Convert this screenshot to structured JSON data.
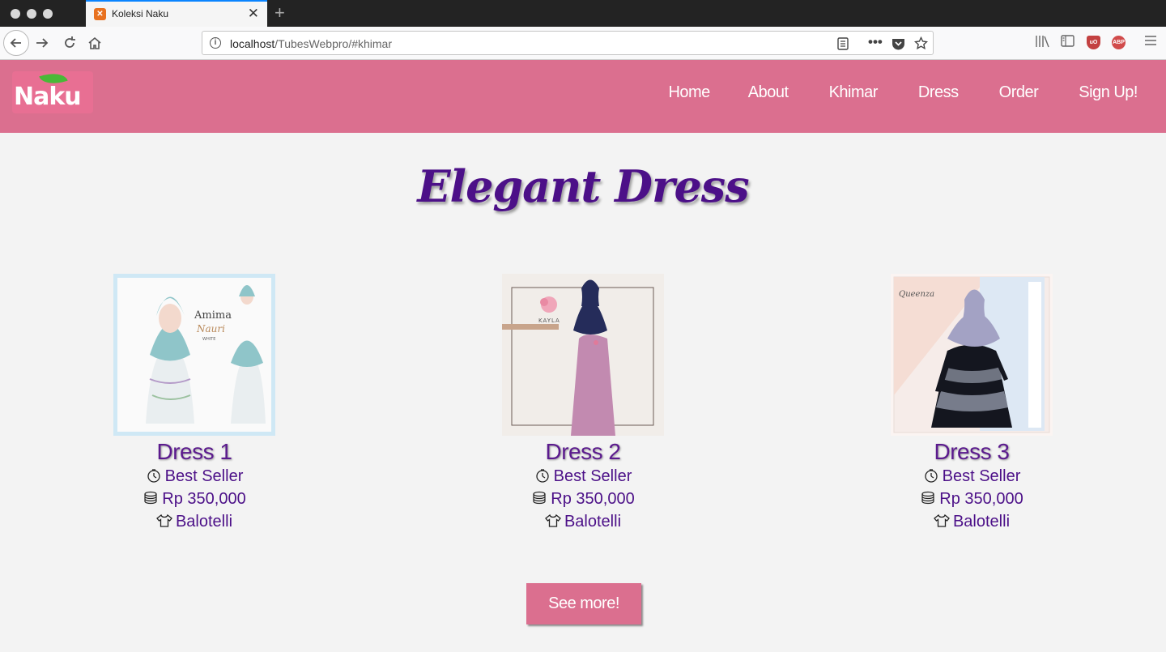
{
  "browser": {
    "tab_title": "Koleksi Naku",
    "url_host": "localhost",
    "url_path": "/TubesWebpro/#khimar"
  },
  "site": {
    "logo_text": "Naku",
    "nav": [
      "Home",
      "About",
      "Khimar",
      "Dress",
      "Order",
      "Sign Up!"
    ]
  },
  "section": {
    "title": "Elegant Dress",
    "products": [
      {
        "name": "Dress 1",
        "tag": "Best Seller",
        "price": "Rp 350,000",
        "brand": "Balotelli"
      },
      {
        "name": "Dress 2",
        "tag": "Best Seller",
        "price": "Rp 350,000",
        "brand": "Balotelli"
      },
      {
        "name": "Dress 3",
        "tag": "Best Seller",
        "price": "Rp 350,000",
        "brand": "Balotelli"
      }
    ],
    "thumb_labels": {
      "p1": [
        "Amima",
        "Nauri",
        "WHITE"
      ],
      "p2": [
        "KAYLA"
      ],
      "p3": [
        "Queenza"
      ]
    },
    "see_more": "See more!"
  },
  "colors": {
    "header": "#db6f8f",
    "title": "#4c1088",
    "accent": "#5b1a8e"
  }
}
